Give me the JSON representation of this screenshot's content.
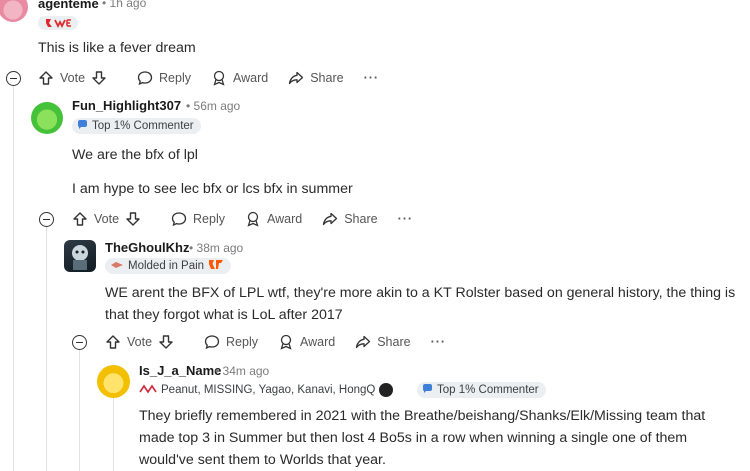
{
  "comments": [
    {
      "username": "agenteme",
      "time": "• 1h ago",
      "body": [
        "This is like a fever dream"
      ]
    },
    {
      "username": "Fun_Highlight307",
      "time": "• 56m ago",
      "flair": "Top 1% Commenter",
      "body": [
        "We are the bfx of lpl",
        "I am hype to see lec bfx or lcs bfx in summer"
      ]
    },
    {
      "username": "TheGhoulKhz",
      "time": "• 38m ago",
      "flair": "Molded in Pain",
      "body": [
        "WE arent the BFX of LPL wtf, they're more akin to a KT Rolster based on general history, the thing is that they forgot what is LoL after 2017"
      ]
    },
    {
      "username": "Is_J_a_Name",
      "time": "• 34m ago",
      "flair": "Peanut, MISSING, Yagao, Kanavi, HongQ",
      "flair2": "Top 1% Commenter",
      "body": [
        "They briefly remembered in 2021 with the Breathe/beishang/Shanks/Elk/Missing team that made top 3 in Summer but then lost 4 Bo5s in a row when winning a single one of them would've sent them to Worlds that year."
      ]
    }
  ],
  "actions": {
    "vote": "Vote",
    "reply": "Reply",
    "award": "Award",
    "share": "Share",
    "more": "···"
  },
  "colors": {
    "thread_line": "#dfe3e6",
    "flair_bg": "#eceff1",
    "meta": "#7c7c7c"
  },
  "icons": [
    "upvote-icon",
    "downvote-icon",
    "reply-icon",
    "award-icon",
    "share-icon",
    "collapse-icon"
  ]
}
